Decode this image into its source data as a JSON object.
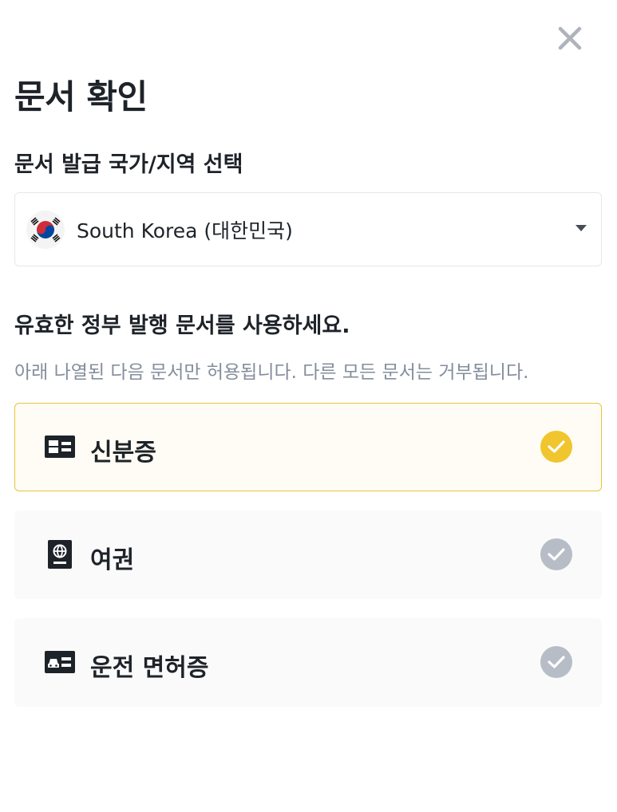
{
  "modal": {
    "title": "문서 확인",
    "close_icon": "close-icon"
  },
  "country": {
    "label": "문서 발급 국가/지역 선택",
    "selected": "South Korea (대한민국)",
    "flag_icon": "south-korea-flag-icon"
  },
  "instructions": {
    "heading": "유효한 정부 발행 문서를 사용하세요.",
    "subtext": "아래 나열된 다음 문서만 허용됩니다. 다른 모든 문서는 거부됩니다."
  },
  "documents": [
    {
      "label": "신분증",
      "icon": "id-card-icon",
      "selected": true
    },
    {
      "label": "여권",
      "icon": "passport-icon",
      "selected": false
    },
    {
      "label": "운전 면허증",
      "icon": "drivers-license-icon",
      "selected": false
    }
  ],
  "colors": {
    "accent": "#f0c52e",
    "selected_border": "#e8c33c",
    "check_inactive": "#b7bdc6",
    "text_primary": "#1e2329",
    "text_secondary": "#848e9c"
  }
}
